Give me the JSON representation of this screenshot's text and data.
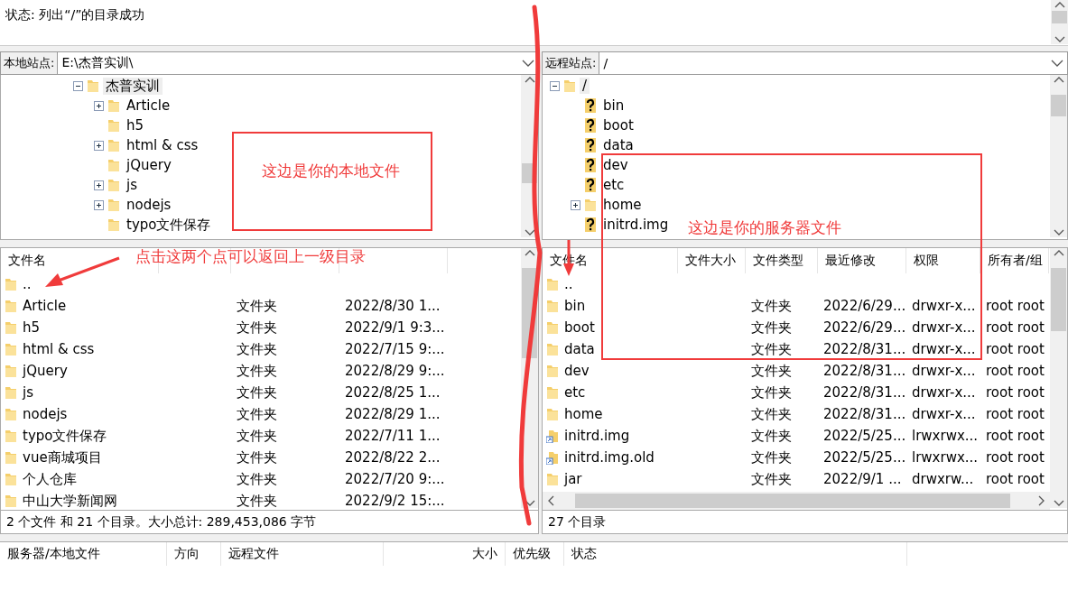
{
  "status_log": {
    "lines": [
      "状态: 列出“/”的目录成功"
    ]
  },
  "local": {
    "site_label": "本地站点:",
    "path": "E:\\杰普实训\\",
    "tree": [
      {
        "name": "杰普实训",
        "kind": "folder",
        "expandable": true,
        "expanded": true,
        "selected": true,
        "children": [
          {
            "name": "Article",
            "kind": "folder",
            "expandable": true,
            "expanded": false,
            "selected": false
          },
          {
            "name": "h5",
            "kind": "folder",
            "expandable": false,
            "selected": false
          },
          {
            "name": "html & css",
            "kind": "folder",
            "expandable": true,
            "expanded": false,
            "selected": false
          },
          {
            "name": "jQuery",
            "kind": "folder",
            "expandable": false,
            "selected": false
          },
          {
            "name": "js",
            "kind": "folder",
            "expandable": true,
            "expanded": false,
            "selected": false
          },
          {
            "name": "nodejs",
            "kind": "folder",
            "expandable": true,
            "expanded": false,
            "selected": false
          },
          {
            "name": "typo文件保存",
            "kind": "folder",
            "expandable": false,
            "selected": false
          }
        ]
      }
    ],
    "columns": [
      {
        "label": "文件名"
      }
    ],
    "rows": [
      {
        "name": "..",
        "kind": "folder"
      },
      {
        "name": "Article",
        "kind": "folder",
        "type": "文件夹",
        "modified": "2022/8/30 1..."
      },
      {
        "name": "h5",
        "kind": "folder",
        "type": "文件夹",
        "modified": "2022/9/1 9:3..."
      },
      {
        "name": "html & css",
        "kind": "folder",
        "type": "文件夹",
        "modified": "2022/7/15 9:..."
      },
      {
        "name": "jQuery",
        "kind": "folder",
        "type": "文件夹",
        "modified": "2022/8/29 9:..."
      },
      {
        "name": "js",
        "kind": "folder",
        "type": "文件夹",
        "modified": "2022/8/25 1..."
      },
      {
        "name": "nodejs",
        "kind": "folder",
        "type": "文件夹",
        "modified": "2022/8/29 1..."
      },
      {
        "name": "typo文件保存",
        "kind": "folder",
        "type": "文件夹",
        "modified": "2022/7/11 1..."
      },
      {
        "name": "vue商城项目",
        "kind": "folder",
        "type": "文件夹",
        "modified": "2022/8/22 2..."
      },
      {
        "name": "个人仓库",
        "kind": "folder",
        "type": "文件夹",
        "modified": "2022/7/20 9:..."
      },
      {
        "name": "中山大学新闻网",
        "kind": "folder",
        "type": "文件夹",
        "modified": "2022/9/2 15:..."
      }
    ],
    "status": "2 个文件 和 21 个目录。大小总计: 289,453,086 字节"
  },
  "remote": {
    "site_label": "远程站点:",
    "path": "/",
    "tree": [
      {
        "name": "/",
        "kind": "folder",
        "expandable": true,
        "expanded": true,
        "selected": true,
        "children": [
          {
            "name": "bin",
            "kind": "unknown",
            "expandable": false,
            "selected": false
          },
          {
            "name": "boot",
            "kind": "unknown",
            "expandable": false,
            "selected": false
          },
          {
            "name": "data",
            "kind": "unknown",
            "expandable": false,
            "selected": false
          },
          {
            "name": "dev",
            "kind": "unknown",
            "expandable": false,
            "selected": false
          },
          {
            "name": "etc",
            "kind": "unknown",
            "expandable": false,
            "selected": false
          },
          {
            "name": "home",
            "kind": "folder",
            "expandable": true,
            "expanded": false,
            "selected": false
          },
          {
            "name": "initrd.img",
            "kind": "unknown",
            "expandable": false,
            "selected": false
          }
        ]
      }
    ],
    "columns": [
      {
        "label": "文件名"
      },
      {
        "label": "文件大小"
      },
      {
        "label": "文件类型"
      },
      {
        "label": "最近修改"
      },
      {
        "label": "权限"
      },
      {
        "label": "所有者/组"
      }
    ],
    "rows": [
      {
        "name": "..",
        "kind": "folder"
      },
      {
        "name": "bin",
        "kind": "folder",
        "type": "文件夹",
        "modified": "2022/6/29...",
        "perms": "drwxr-x...",
        "owner": "root root"
      },
      {
        "name": "boot",
        "kind": "folder",
        "type": "文件夹",
        "modified": "2022/6/29...",
        "perms": "drwxr-x...",
        "owner": "root root"
      },
      {
        "name": "data",
        "kind": "folder",
        "type": "文件夹",
        "modified": "2022/8/31...",
        "perms": "drwxr-x...",
        "owner": "root root"
      },
      {
        "name": "dev",
        "kind": "folder",
        "type": "文件夹",
        "modified": "2022/8/31...",
        "perms": "drwxr-x...",
        "owner": "root root"
      },
      {
        "name": "etc",
        "kind": "folder",
        "type": "文件夹",
        "modified": "2022/8/31...",
        "perms": "drwxr-x...",
        "owner": "root root"
      },
      {
        "name": "home",
        "kind": "folder",
        "type": "文件夹",
        "modified": "2022/8/31...",
        "perms": "drwxr-x...",
        "owner": "root root"
      },
      {
        "name": "initrd.img",
        "kind": "link",
        "type": "文件夹",
        "modified": "2022/5/25...",
        "perms": "lrwxrwx...",
        "owner": "root root"
      },
      {
        "name": "initrd.img.old",
        "kind": "link",
        "type": "文件夹",
        "modified": "2022/5/25...",
        "perms": "lrwxrwx...",
        "owner": "root root"
      },
      {
        "name": "jar",
        "kind": "folder",
        "type": "文件夹",
        "modified": "2022/9/1 ...",
        "perms": "drwxrw...",
        "owner": "root root"
      }
    ],
    "status": "27 个目录"
  },
  "queue": {
    "columns": [
      {
        "label": "服务器/本地文件"
      },
      {
        "label": "方向"
      },
      {
        "label": "远程文件"
      },
      {
        "label": "大小"
      },
      {
        "label": "优先级"
      },
      {
        "label": "状态"
      }
    ]
  },
  "annotations": [
    {
      "text": "这边是你的本地文件"
    },
    {
      "text": "点击这两个点可以返回上一级目录"
    },
    {
      "text": "这边是你的服务器文件"
    }
  ]
}
